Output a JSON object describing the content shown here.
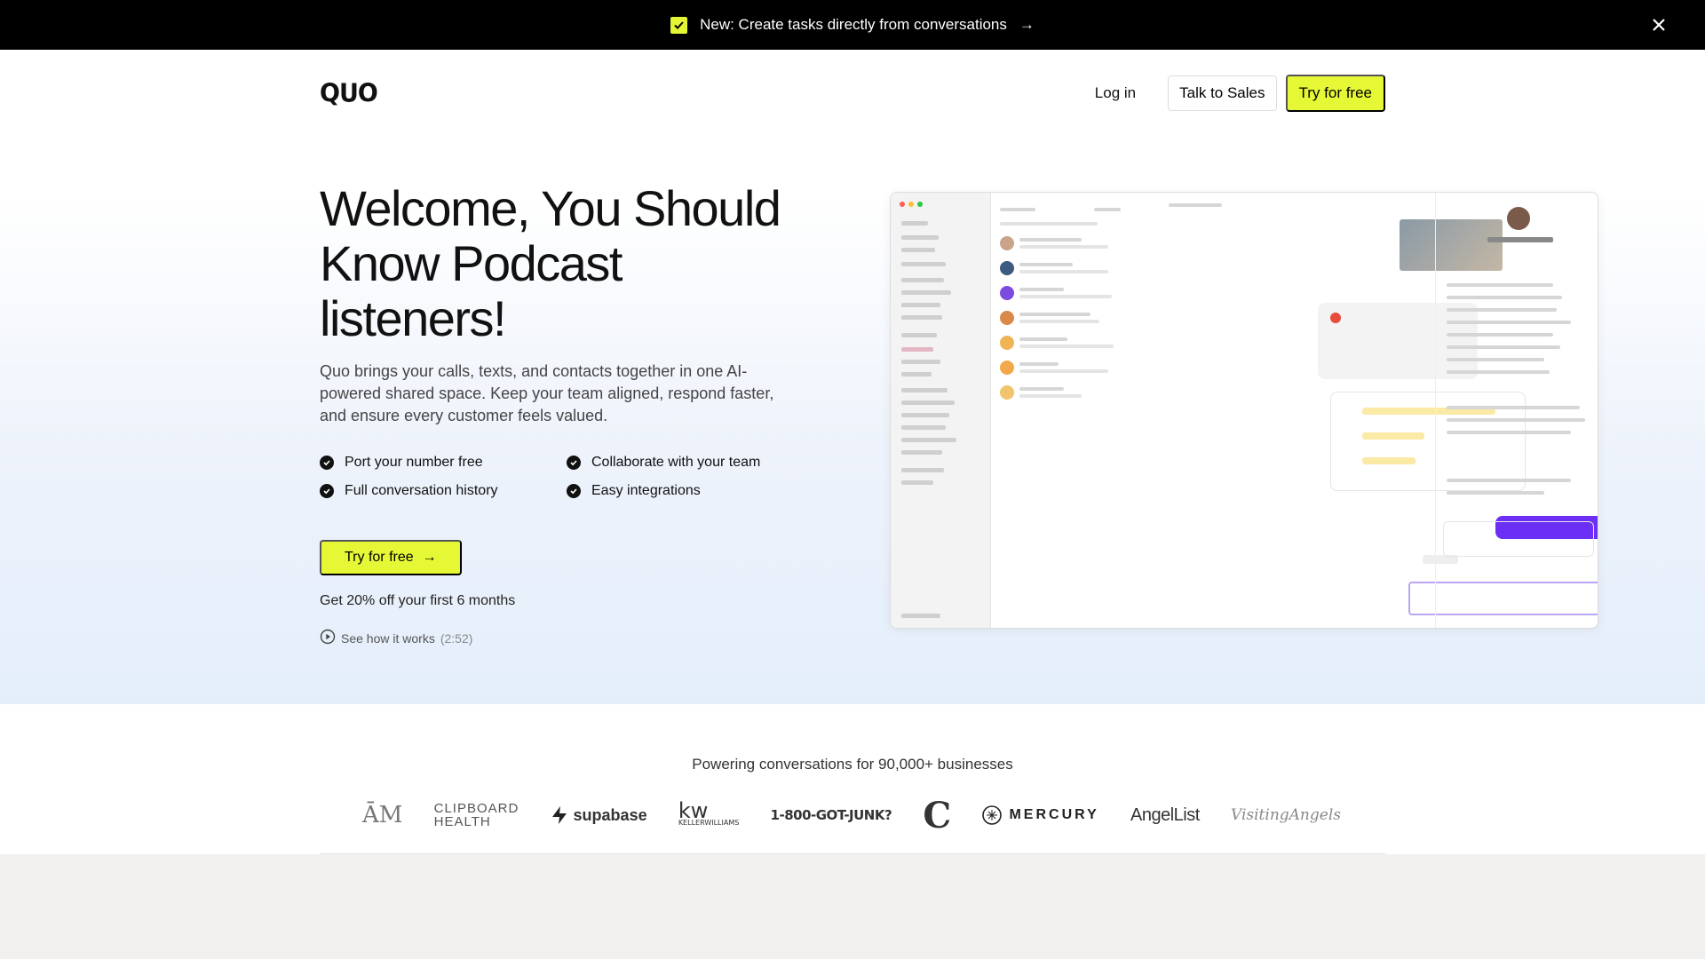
{
  "announcement": {
    "text": "New: Create tasks directly from conversations",
    "arrow": "→"
  },
  "nav": {
    "logo": "QUO",
    "login": "Log in",
    "sales": "Talk to Sales",
    "try": "Try for free"
  },
  "hero": {
    "headline": "Welcome, You Should Know Podcast listeners!",
    "subtext": "Quo brings your calls, texts, and contacts together in one AI-powered shared space. Keep your team aligned, respond faster, and ensure every customer feels valued.",
    "features": [
      "Port your number free",
      "Collaborate with your team",
      "Full conversation history",
      "Easy integrations"
    ],
    "cta": "Try for free",
    "cta_arrow": "→",
    "discount": "Get 20% off your first 6 months",
    "video_label": "See how it works",
    "video_duration": "(2:52)"
  },
  "logos": {
    "powering": "Powering conversations for 90,000+ businesses",
    "brands": {
      "tam": "ĀM",
      "clipboard_1": "CLIPBOARD",
      "clipboard_2": "HEALTH",
      "supabase": "supabase",
      "kw": "kw",
      "kw_sub": "KELLERWILLIAMS",
      "junk": "1-800-GOT-JUNK?",
      "c": "C",
      "mercury": "MERCURY",
      "angellist": "AngelList",
      "visiting": "VisitingAngels"
    }
  },
  "colors": {
    "accent": "#e6f835",
    "dark": "#000000",
    "hero_bg_bottom": "#e4eefb",
    "page_bg": "#f2f0ee"
  }
}
